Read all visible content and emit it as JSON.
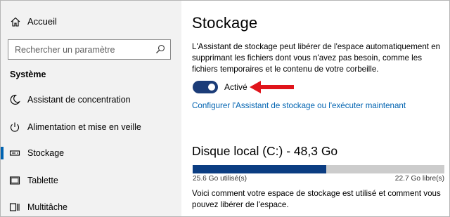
{
  "sidebar": {
    "home": {
      "label": "Accueil",
      "icon": "home-icon"
    },
    "search": {
      "placeholder": "Rechercher un paramètre",
      "icon": "search-icon"
    },
    "section_title": "Système",
    "items": [
      {
        "label": "Assistant de concentration",
        "icon": "moon-icon",
        "active": false
      },
      {
        "label": "Alimentation et mise en veille",
        "icon": "power-icon",
        "active": false
      },
      {
        "label": "Stockage",
        "icon": "storage-icon",
        "active": true
      },
      {
        "label": "Tablette",
        "icon": "tablet-icon",
        "active": false
      },
      {
        "label": "Multitâche",
        "icon": "multitask-icon",
        "active": false
      }
    ]
  },
  "main": {
    "title": "Stockage",
    "description": "L'Assistant de stockage peut libérer de l'espace automatiquement en supprimant les fichiers dont vous n'avez pas besoin, comme les fichiers temporaires et le contenu de votre corbeille.",
    "toggle": {
      "label": "Activé",
      "on": true
    },
    "link": "Configurer l'Assistant de stockage ou l'exécuter maintenant",
    "disk": {
      "title": "Disque local (C:) - 48,3 Go",
      "used_label": "25.6 Go utilisé(s)",
      "free_label": "22.7 Go libre(s)",
      "used_fraction": 0.53
    },
    "info": "Voici comment votre espace de stockage est utilisé et comment vous pouvez libérer de l'espace."
  },
  "colors": {
    "accent": "#0063b1",
    "toggle_on": "#1b3c78",
    "bar_fill": "#0b3d82",
    "bar_empty": "#cccccc",
    "annotation_arrow": "#e0141b",
    "sidebar_bg": "#f2f2f2"
  }
}
